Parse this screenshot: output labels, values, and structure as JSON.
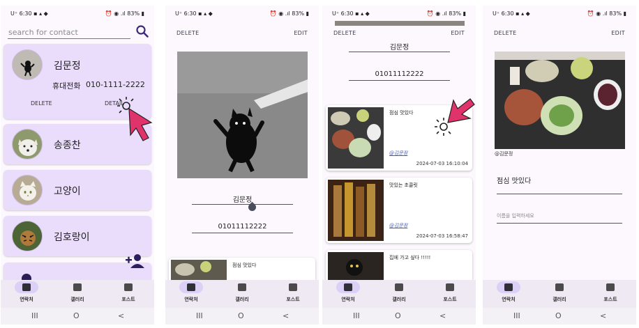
{
  "status": {
    "time": "6:30",
    "carrier": "U⁺",
    "battery": "83%"
  },
  "nav": {
    "contacts": "연락처",
    "gallery": "갤러리",
    "posts": "포스트"
  },
  "sysbar": {
    "recent": "III",
    "home": "O",
    "back": "<"
  },
  "screen1": {
    "search_placeholder": "search for contact",
    "contacts": [
      {
        "name": "김문정",
        "phone_label": "휴대전화",
        "phone": "010-1111-2222",
        "delete": "DELETE",
        "detail": "DETAIL"
      },
      {
        "name": "송종찬"
      },
      {
        "name": "고양이"
      },
      {
        "name": "김호랑이"
      }
    ]
  },
  "screen2": {
    "delete": "DELETE",
    "edit": "EDIT",
    "name": "김문정",
    "phone": "01011112222",
    "post_title": "점심 맛있다"
  },
  "screen3": {
    "delete": "DELETE",
    "edit": "EDIT",
    "name": "김문정",
    "phone": "01011112222",
    "posts": [
      {
        "title": "점심 맛있다",
        "author": "@김문정",
        "date": "2024-07-03 16:10:04"
      },
      {
        "title": "맛있는 초콜릿",
        "author": "@김문정",
        "date": "2024-07-03 16:58:47"
      },
      {
        "title": "집에 가고 싶다 !!!!!"
      }
    ]
  },
  "screen4": {
    "delete": "DELETE",
    "edit": "EDIT",
    "author": "@김문정",
    "post_title": "점심 맛있다",
    "comment_placeholder": "이름을 입력하세요"
  },
  "colors": {
    "card": "#e9ddfb",
    "accent": "#5a3e8c",
    "pointer": "#e0336b"
  }
}
